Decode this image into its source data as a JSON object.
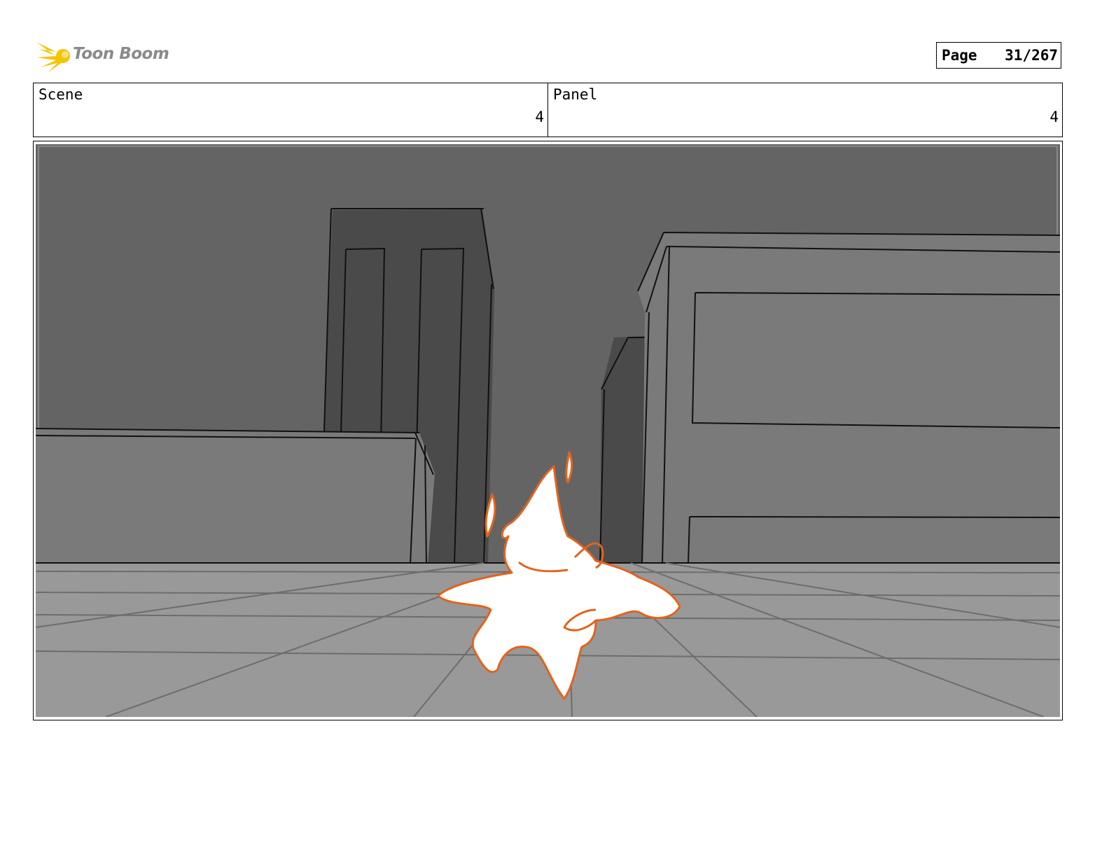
{
  "header": {
    "logo_text": "Toon Boom",
    "page_label": "Page",
    "page_number": "31/267"
  },
  "info": {
    "scene_label": "Scene",
    "scene_value": "4",
    "panel_label": "Panel",
    "panel_value": "4"
  },
  "colors": {
    "logo_yellow": "#f5c400",
    "sky": "#646464",
    "dark_building": "#4a4a4a",
    "mid_building": "#7a7a7a",
    "ground": "#999999",
    "character_outline": "#e2641c",
    "character_fill": "#ffffff"
  }
}
